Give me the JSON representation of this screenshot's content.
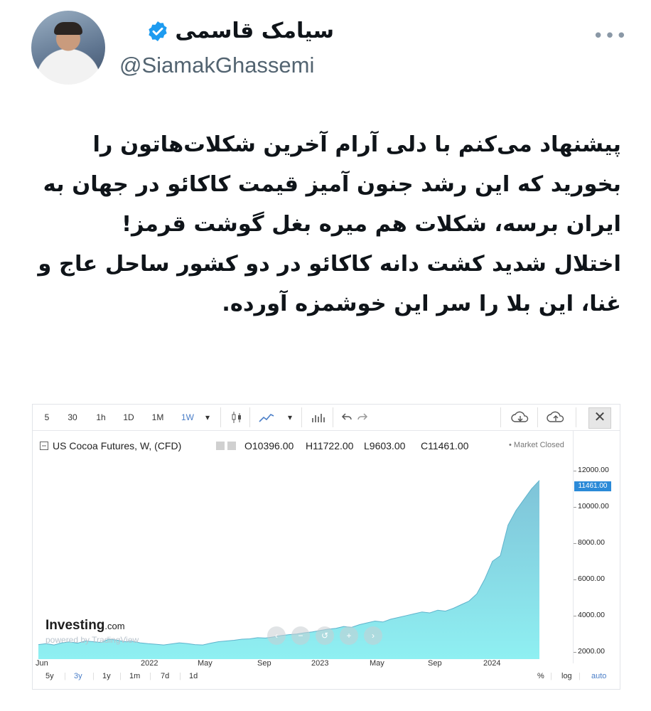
{
  "author": {
    "name": "سیامک قاسمی",
    "handle": "@SiamakGhassemi",
    "verified_icon": "verified-badge-icon",
    "more_label": "•••"
  },
  "tweet": {
    "line1": "پیشنهاد می‌کنم با دلی آرام آخرین شکلات‌هاتون را",
    "line2": "بخورید که این رشد جنون آمیز قیمت کاکائو در جهان به",
    "line3": "ایران برسه، شکلات هم میره بغل گوشت قرمز!",
    "line4": "اختلال شدید کشت دانه کاکائو در دو کشور ساحل عاج و",
    "line5": "غنا، این بلا را سر این خوشمزه آورده."
  },
  "chart_toolbar": {
    "intervals": [
      "5",
      "30",
      "1h",
      "1D",
      "1M",
      "1W"
    ],
    "active_interval": "1W",
    "dropdown_label": "▾"
  },
  "chart_legend": {
    "symbol": "US Cocoa Futures, W, (CFD)",
    "open": "O10396.00",
    "high": "H11722.00",
    "low": "L9603.00",
    "close": "C11461.00",
    "status": "• Market Closed"
  },
  "chart_brand": {
    "name": "Investing",
    "suffix": ".com",
    "powered": "powered by TradingView"
  },
  "bottom_bar": {
    "ranges": [
      "5y",
      "3y",
      "1y",
      "1m",
      "7d",
      "1d"
    ],
    "active_range": "3y",
    "percent": "%",
    "log": "log",
    "auto": "auto"
  },
  "colors": {
    "accent": "#2b8ad8",
    "area_top": "#7fc6d9",
    "area_bottom": "#8eeef0"
  },
  "chart_data": {
    "type": "area",
    "x_ticks": [
      "Jun",
      "2022",
      "May",
      "Sep",
      "2023",
      "May",
      "Sep",
      "2024"
    ],
    "y_ticks": [
      "12000.00",
      "10000.00",
      "8000.00",
      "6000.00",
      "4000.00",
      "2000.00"
    ],
    "ylim": [
      1600,
      12900
    ],
    "last_price_label": "11461.00",
    "series": [
      {
        "values": [
          2400,
          2450,
          2380,
          2500,
          2550,
          2480,
          2600,
          2560,
          2520,
          2700,
          2650,
          2560,
          2580,
          2500,
          2450,
          2420,
          2380,
          2440,
          2500,
          2460,
          2400,
          2380,
          2480,
          2560,
          2600,
          2640,
          2700,
          2720,
          2780,
          2760,
          2820,
          2900,
          2950,
          2980,
          3050,
          3100,
          3180,
          3250,
          3300,
          3400,
          3350,
          3500,
          3600,
          3700,
          3650,
          3800,
          3900,
          4000,
          4100,
          4200,
          4150,
          4300,
          4250,
          4400,
          4600,
          4800,
          5200,
          6000,
          7000,
          7300,
          9000,
          9800,
          10400,
          11000,
          11461
        ]
      }
    ]
  }
}
